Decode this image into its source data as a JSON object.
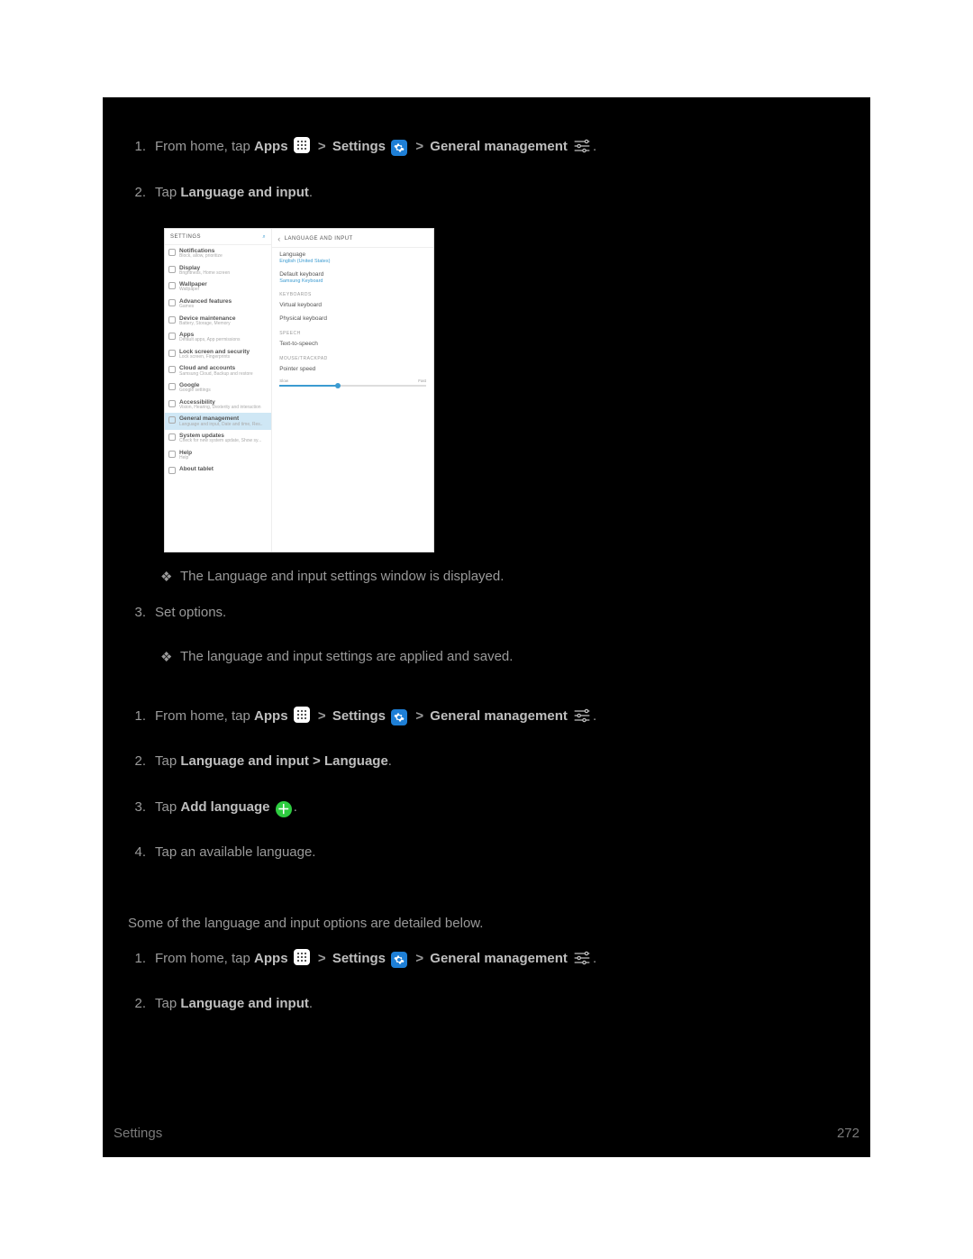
{
  "footer": {
    "section": "Settings",
    "page": "272"
  },
  "steps1": {
    "n1": "1.",
    "s1": {
      "pre": "From home, tap ",
      "apps": "Apps",
      "gt": ">",
      "settings": "Settings",
      "gm": "General management"
    },
    "n2": "2.",
    "s2": {
      "pre": "Tap ",
      "b": "Language and input",
      "post": "."
    },
    "r1": "The Language and input settings window is displayed.",
    "n3": "3.",
    "s3": "Set options.",
    "r2": "The language and input settings are applied and saved."
  },
  "addLang": {
    "n1": "1.",
    "s1": {
      "pre": "From home, tap ",
      "apps": "Apps",
      "gt": ">",
      "settings": "Settings",
      "gm": "General management"
    },
    "n2": "2.",
    "s2": {
      "pre": "Tap ",
      "b": "Language and input > Language",
      "post": "."
    },
    "n3": "3.",
    "s3": {
      "pre": "Tap ",
      "b": "Add language"
    },
    "n4": "4.",
    "s4": "Tap an available language."
  },
  "overview": {
    "intro": "Some of the language and input options are detailed below.",
    "n1": "1.",
    "s1": {
      "pre": "From home, tap ",
      "apps": "Apps",
      "gt": ">",
      "settings": "Settings",
      "gm": "General management"
    },
    "n2": "2.",
    "s2": {
      "pre": "Tap ",
      "b": "Language and input",
      "post": "."
    }
  },
  "diamond": "❖",
  "screenshot": {
    "leftHeader": "SETTINGS",
    "searchGlyph": "⌕",
    "chevron": "‹",
    "rightHeader": "LANGUAGE AND INPUT",
    "leftItems": [
      {
        "t": "Notifications",
        "s": "Block, allow, prioritize"
      },
      {
        "t": "Display",
        "s": "Brightness, Home screen"
      },
      {
        "t": "Wallpaper",
        "s": "Wallpaper"
      },
      {
        "t": "Advanced features",
        "s": "Games"
      },
      {
        "t": "Device maintenance",
        "s": "Battery, Storage, Memory"
      },
      {
        "t": "Apps",
        "s": "Default apps, App permissions"
      },
      {
        "t": "Lock screen and security",
        "s": "Lock screen, Fingerprints"
      },
      {
        "t": "Cloud and accounts",
        "s": "Samsung Cloud, Backup and restore"
      },
      {
        "t": "Google",
        "s": "Google settings"
      },
      {
        "t": "Accessibility",
        "s": "Vision, Hearing, Dexterity and interaction"
      },
      {
        "t": "General management",
        "s": "Language and input, Date and time, Res..",
        "sel": true
      },
      {
        "t": "System updates",
        "s": "Check for new system update, Show sy..."
      },
      {
        "t": "Help",
        "s": "Help"
      },
      {
        "t": "About tablet",
        "s": ""
      }
    ],
    "right": {
      "lang": {
        "t": "Language",
        "s": "English (United States)"
      },
      "defkb": {
        "t": "Default keyboard",
        "s": "Samsung Keyboard"
      },
      "catKeyboards": "KEYBOARDS",
      "vkb": "Virtual keyboard",
      "pkb": "Physical keyboard",
      "catSpeech": "SPEECH",
      "tts": "Text-to-speech",
      "catMouse": "MOUSE/TRACKPAD",
      "pspeed": "Pointer speed",
      "slow": "Slow",
      "fast": "Fast"
    }
  }
}
